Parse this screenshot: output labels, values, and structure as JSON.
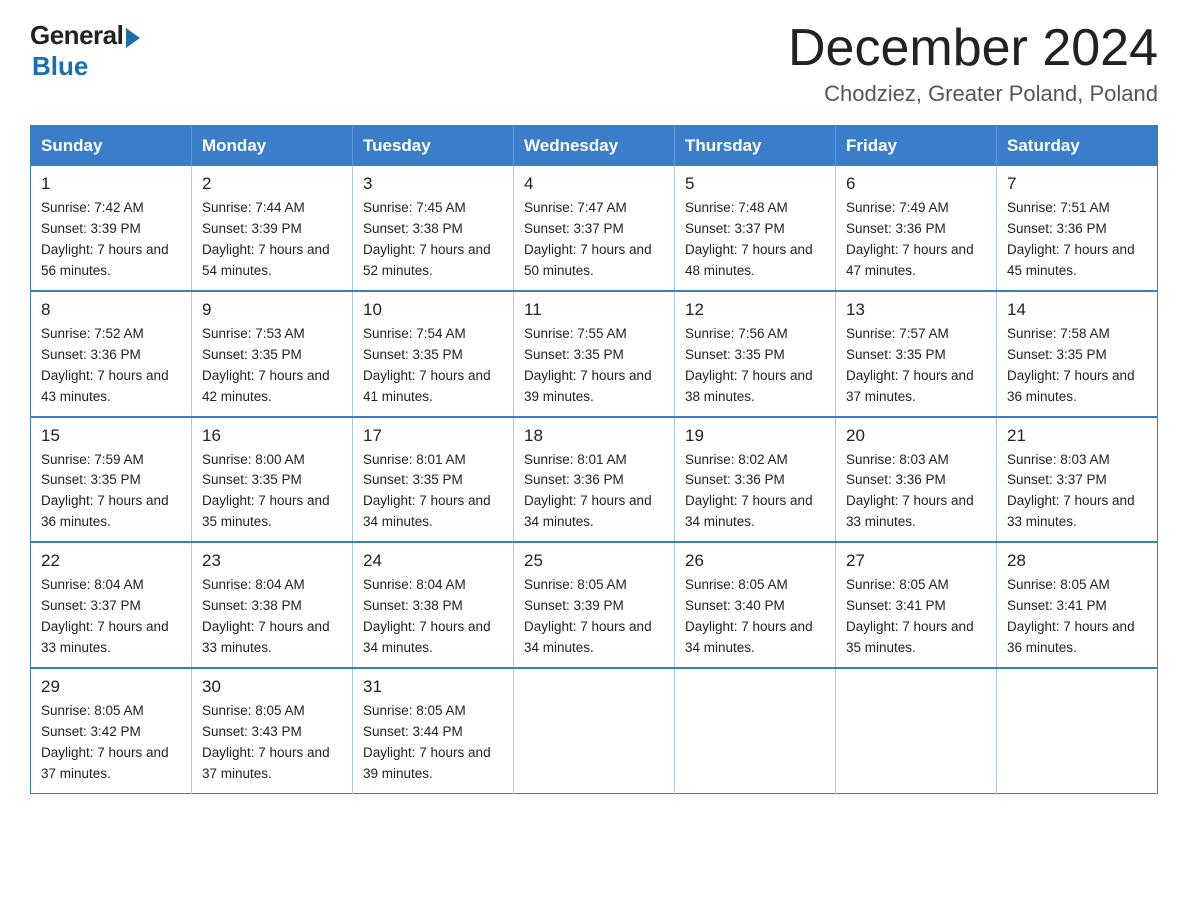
{
  "logo": {
    "general": "General",
    "blue": "Blue"
  },
  "title": {
    "month": "December 2024",
    "location": "Chodziez, Greater Poland, Poland"
  },
  "weekdays": [
    "Sunday",
    "Monday",
    "Tuesday",
    "Wednesday",
    "Thursday",
    "Friday",
    "Saturday"
  ],
  "weeks": [
    [
      {
        "day": "1",
        "sunrise": "7:42 AM",
        "sunset": "3:39 PM",
        "daylight": "7 hours and 56 minutes."
      },
      {
        "day": "2",
        "sunrise": "7:44 AM",
        "sunset": "3:39 PM",
        "daylight": "7 hours and 54 minutes."
      },
      {
        "day": "3",
        "sunrise": "7:45 AM",
        "sunset": "3:38 PM",
        "daylight": "7 hours and 52 minutes."
      },
      {
        "day": "4",
        "sunrise": "7:47 AM",
        "sunset": "3:37 PM",
        "daylight": "7 hours and 50 minutes."
      },
      {
        "day": "5",
        "sunrise": "7:48 AM",
        "sunset": "3:37 PM",
        "daylight": "7 hours and 48 minutes."
      },
      {
        "day": "6",
        "sunrise": "7:49 AM",
        "sunset": "3:36 PM",
        "daylight": "7 hours and 47 minutes."
      },
      {
        "day": "7",
        "sunrise": "7:51 AM",
        "sunset": "3:36 PM",
        "daylight": "7 hours and 45 minutes."
      }
    ],
    [
      {
        "day": "8",
        "sunrise": "7:52 AM",
        "sunset": "3:36 PM",
        "daylight": "7 hours and 43 minutes."
      },
      {
        "day": "9",
        "sunrise": "7:53 AM",
        "sunset": "3:35 PM",
        "daylight": "7 hours and 42 minutes."
      },
      {
        "day": "10",
        "sunrise": "7:54 AM",
        "sunset": "3:35 PM",
        "daylight": "7 hours and 41 minutes."
      },
      {
        "day": "11",
        "sunrise": "7:55 AM",
        "sunset": "3:35 PM",
        "daylight": "7 hours and 39 minutes."
      },
      {
        "day": "12",
        "sunrise": "7:56 AM",
        "sunset": "3:35 PM",
        "daylight": "7 hours and 38 minutes."
      },
      {
        "day": "13",
        "sunrise": "7:57 AM",
        "sunset": "3:35 PM",
        "daylight": "7 hours and 37 minutes."
      },
      {
        "day": "14",
        "sunrise": "7:58 AM",
        "sunset": "3:35 PM",
        "daylight": "7 hours and 36 minutes."
      }
    ],
    [
      {
        "day": "15",
        "sunrise": "7:59 AM",
        "sunset": "3:35 PM",
        "daylight": "7 hours and 36 minutes."
      },
      {
        "day": "16",
        "sunrise": "8:00 AM",
        "sunset": "3:35 PM",
        "daylight": "7 hours and 35 minutes."
      },
      {
        "day": "17",
        "sunrise": "8:01 AM",
        "sunset": "3:35 PM",
        "daylight": "7 hours and 34 minutes."
      },
      {
        "day": "18",
        "sunrise": "8:01 AM",
        "sunset": "3:36 PM",
        "daylight": "7 hours and 34 minutes."
      },
      {
        "day": "19",
        "sunrise": "8:02 AM",
        "sunset": "3:36 PM",
        "daylight": "7 hours and 34 minutes."
      },
      {
        "day": "20",
        "sunrise": "8:03 AM",
        "sunset": "3:36 PM",
        "daylight": "7 hours and 33 minutes."
      },
      {
        "day": "21",
        "sunrise": "8:03 AM",
        "sunset": "3:37 PM",
        "daylight": "7 hours and 33 minutes."
      }
    ],
    [
      {
        "day": "22",
        "sunrise": "8:04 AM",
        "sunset": "3:37 PM",
        "daylight": "7 hours and 33 minutes."
      },
      {
        "day": "23",
        "sunrise": "8:04 AM",
        "sunset": "3:38 PM",
        "daylight": "7 hours and 33 minutes."
      },
      {
        "day": "24",
        "sunrise": "8:04 AM",
        "sunset": "3:38 PM",
        "daylight": "7 hours and 34 minutes."
      },
      {
        "day": "25",
        "sunrise": "8:05 AM",
        "sunset": "3:39 PM",
        "daylight": "7 hours and 34 minutes."
      },
      {
        "day": "26",
        "sunrise": "8:05 AM",
        "sunset": "3:40 PM",
        "daylight": "7 hours and 34 minutes."
      },
      {
        "day": "27",
        "sunrise": "8:05 AM",
        "sunset": "3:41 PM",
        "daylight": "7 hours and 35 minutes."
      },
      {
        "day": "28",
        "sunrise": "8:05 AM",
        "sunset": "3:41 PM",
        "daylight": "7 hours and 36 minutes."
      }
    ],
    [
      {
        "day": "29",
        "sunrise": "8:05 AM",
        "sunset": "3:42 PM",
        "daylight": "7 hours and 37 minutes."
      },
      {
        "day": "30",
        "sunrise": "8:05 AM",
        "sunset": "3:43 PM",
        "daylight": "7 hours and 37 minutes."
      },
      {
        "day": "31",
        "sunrise": "8:05 AM",
        "sunset": "3:44 PM",
        "daylight": "7 hours and 39 minutes."
      },
      null,
      null,
      null,
      null
    ]
  ]
}
